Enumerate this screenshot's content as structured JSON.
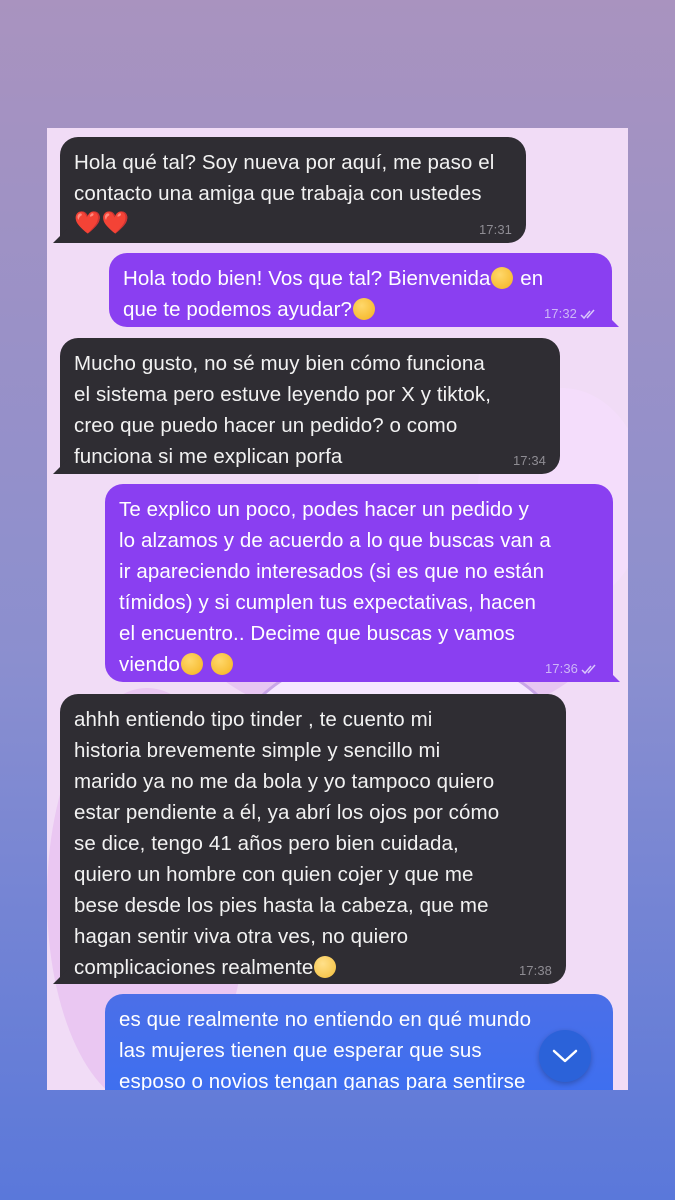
{
  "messages": [
    {
      "direction": "incoming",
      "text": "Hola qué tal? Soy nueva por aquí, me paso el\ncontacto una amiga que trabaja con ustedes",
      "emoji_line": "❤️❤️",
      "time": "17:31"
    },
    {
      "direction": "outgoing",
      "text_a": "Hola todo bien! Vos que tal? Bienvenida",
      "emoji_a": "smiling-face-with-hearts",
      "text_b": " en\nque te podemos ayudar?",
      "emoji_b": "face-blowing-kiss",
      "time": "17:32",
      "read_ticks": "double-check"
    },
    {
      "direction": "incoming",
      "text": "Mucho gusto, no sé muy bien cómo funciona\nel sistema pero estuve leyendo por X y tiktok,\ncreo que puedo hacer un pedido? o como\nfunciona si me explican porfa",
      "time": "17:34"
    },
    {
      "direction": "outgoing",
      "text": "Te explico un poco, podes hacer un pedido y\nlo alzamos y de acuerdo a lo que buscas van a\nir apareciendo interesados (si es que no están\ntímidos) y si cumplen tus expectativas, hacen\nel encuentro.. Decime que buscas y vamos\nviendo",
      "emoji": "smiling-face-with-hearts",
      "time": "17:36",
      "read_ticks": "double-check"
    },
    {
      "direction": "incoming",
      "text": "ahhh entiendo tipo tinder , te cuento mi\nhistoria brevemente simple y sencillo mi\nmarido ya no me da bola y yo tampoco quiero\nestar pendiente a él, ya abrí los ojos por cómo\nse dice, tengo 41 años pero bien cuidada,\nquiero un hombre con quien cojer y que me\nbese desde los pies hasta la cabeza, que me\nhagan sentir viva otra ves, no quiero\ncomplicaciones realmente",
      "emoji": "flushed-hot-face",
      "time": "17:38"
    },
    {
      "direction": "outgoing",
      "text": "es que realmente no entiendo en qué mundo\nlas mujeres tienen que esperar que sus\nesposo o novios tengan ganas para sentirse"
    }
  ],
  "scroll_button": {
    "icon": "chevron-down-icon"
  },
  "colors": {
    "incoming": "#2f2d33",
    "outgoing": "#8a3ff1",
    "outgoing_last": "#3a6ff2"
  }
}
